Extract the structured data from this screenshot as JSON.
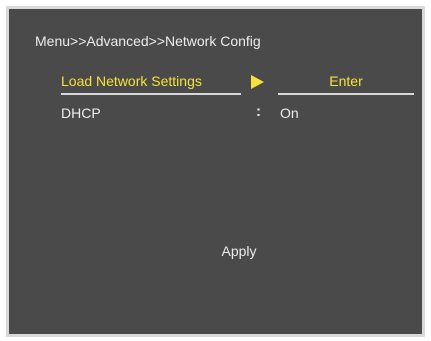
{
  "breadcrumb": "Menu>>Advanced>>Network Config",
  "rows": [
    {
      "label": "Load Network Settings",
      "value": "Enter",
      "selected": true
    },
    {
      "label": "DHCP",
      "separator": ":",
      "value": "On",
      "selected": false
    }
  ],
  "apply_label": "Apply",
  "colors": {
    "background": "#4a4a4a",
    "frame": "#d9d9d9",
    "text": "#ececec",
    "highlight": "#f5e23a"
  },
  "icons": {
    "selection_arrow": "right-triangle-icon"
  }
}
